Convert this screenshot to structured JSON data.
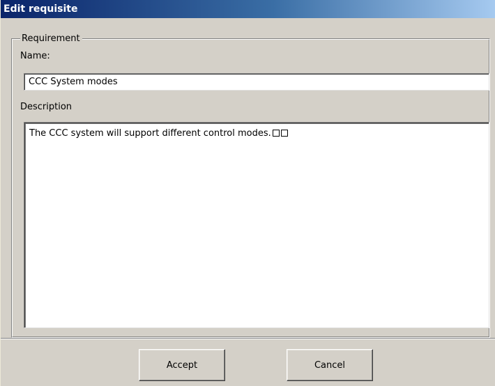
{
  "window": {
    "title": "Edit requisite"
  },
  "group": {
    "label": "Requirement"
  },
  "name_field": {
    "label": "Name:",
    "value": "CCC System modes"
  },
  "description_field": {
    "label": "Description",
    "value": "The CCC system will support different control modes."
  },
  "buttons": {
    "accept_label": "Accept",
    "cancel_label": "Cancel"
  }
}
